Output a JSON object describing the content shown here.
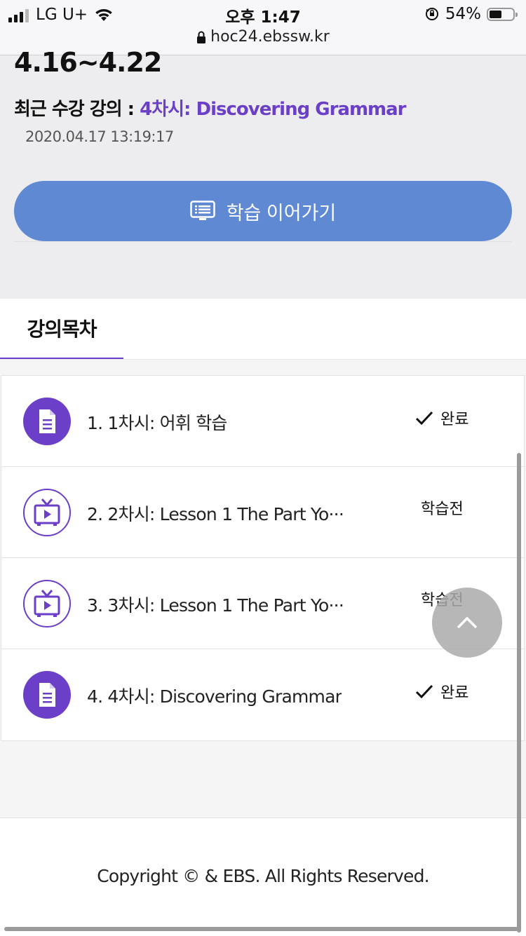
{
  "status_bar": {
    "carrier": "LG U+",
    "time": "오후 1:47",
    "battery_percent": "54%",
    "battery_level": 0.54,
    "url": "hoc24.ebssw.kr"
  },
  "course": {
    "period": "4.16~4.22",
    "recent_label": "최근 수강 강의 : ",
    "recent_lecture": "4차시: Discovering Grammar",
    "recent_datetime": "2020.04.17 13:19:17",
    "continue_label": "학습 이어가기"
  },
  "tabs": {
    "active_label": "강의목차"
  },
  "lessons": [
    {
      "title": "1. 1차시: 어휘 학습",
      "type": "document-icon",
      "status": "완료",
      "done": true
    },
    {
      "title": "2. 2차시: Lesson 1 The Part Yo···",
      "type": "tv-icon",
      "status": "학습전",
      "done": false
    },
    {
      "title": "3. 3차시: Lesson 1 The Part Yo···",
      "type": "tv-icon",
      "status": "학습전",
      "done": false
    },
    {
      "title": "4. 4차시: Discovering Grammar",
      "type": "document-icon",
      "status": "완료",
      "done": true
    }
  ],
  "footer": {
    "copyright": "Copyright © & EBS. All Rights Reserved."
  },
  "colors": {
    "accent_purple": "#6b3fc8",
    "button_blue": "#6089d3"
  }
}
